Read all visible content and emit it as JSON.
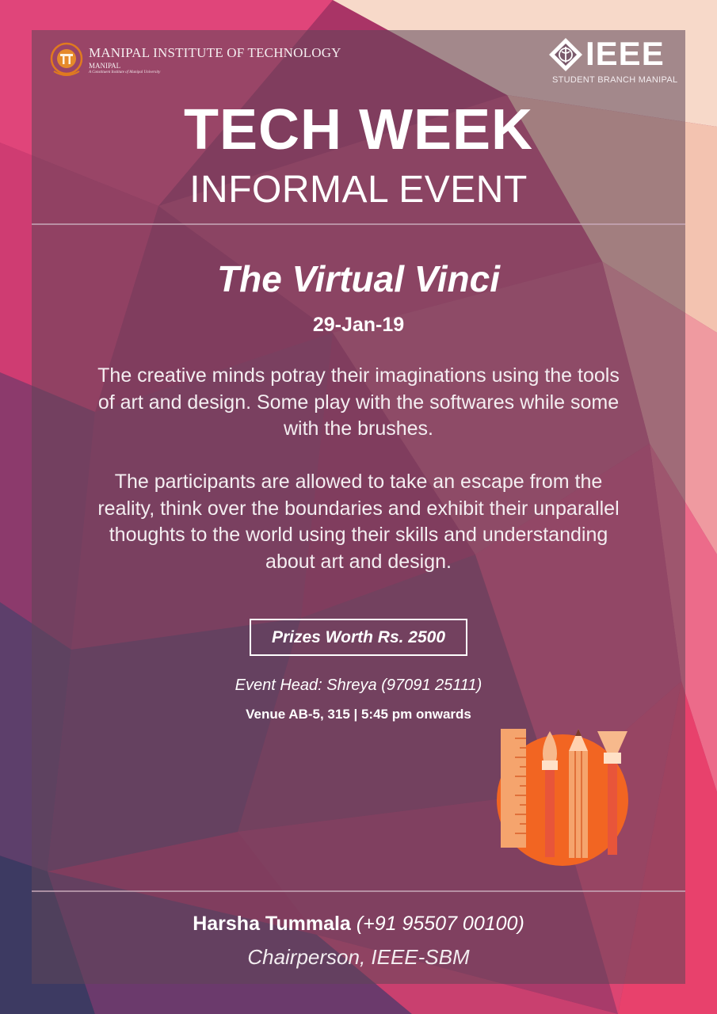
{
  "header": {
    "institute_name": "MANIPAL INSTITUTE OF TECHNOLOGY",
    "institute_city": "MANIPAL",
    "institute_tagline": "A Constituent Institute of Manipal University",
    "ieee_word": "IEEE",
    "ieee_branch": "STUDENT BRANCH MANIPAL"
  },
  "title": {
    "main": "TECH WEEK",
    "sub": "INFORMAL EVENT"
  },
  "event": {
    "name": "The Virtual Vinci",
    "date": "29-Jan-19",
    "description_1": "The creative minds potray their imaginations using the tools of art and design. Some play with the softwares while some with the brushes.",
    "description_2": "The participants are allowed to take an escape from the reality, think over the boundaries and exhibit their unparallel thoughts to the world using their skills and understanding about art and design.",
    "prize": "Prizes Worth Rs. 2500",
    "event_head": "Event Head: Shreya (97091 25111)",
    "venue": "Venue AB-5, 315 | 5:45 pm onwards"
  },
  "footer": {
    "contact_name": "Harsha Tummala",
    "contact_phone": "(+91 95507 00100)",
    "contact_role": "Chairperson, IEEE-SBM"
  },
  "colors": {
    "accent_orange": "#f26522",
    "background_pink": "#d83a66",
    "panel_overlay": "#5f4658"
  }
}
